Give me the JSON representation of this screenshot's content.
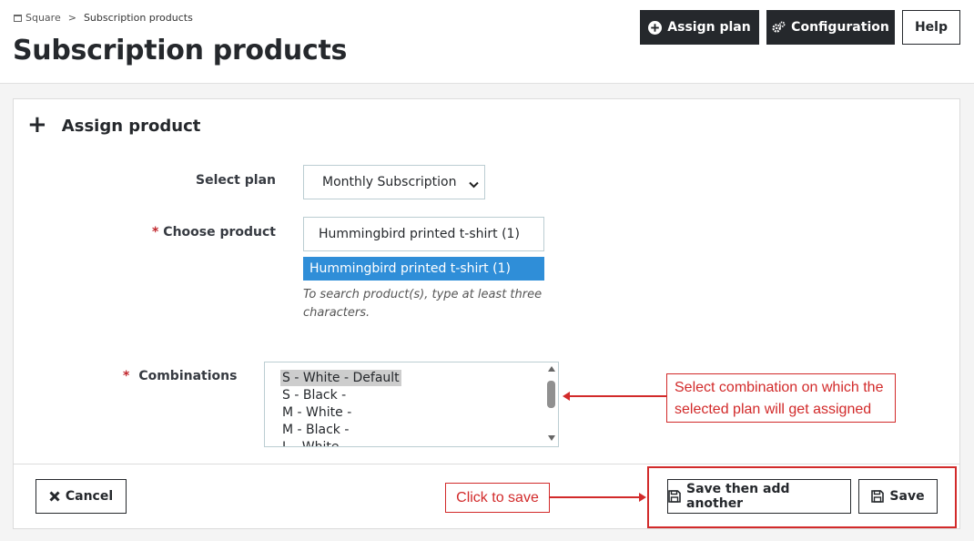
{
  "breadcrumb": {
    "root": "Square",
    "separator": ">",
    "current": "Subscription products"
  },
  "page": {
    "title": "Subscription products"
  },
  "toolbar": {
    "assign_plan": "Assign plan",
    "configuration": "Configuration",
    "help": "Help"
  },
  "panel": {
    "title": "Assign product",
    "select_plan": {
      "label": "Select plan",
      "value": "Monthly Subscription"
    },
    "choose_product": {
      "required_mark": "*",
      "label": "Choose product",
      "value": "Hummingbird printed t-shirt (1)",
      "suggestion": "Hummingbird printed t-shirt (1)",
      "hint": "To search product(s), type at least three characters."
    },
    "combinations": {
      "required_mark": "*",
      "label": "Combinations",
      "options": [
        "S - White - Default",
        "S - Black -",
        "M - White -",
        "M - Black -",
        "L - White -"
      ],
      "selected_index": 0
    }
  },
  "footer": {
    "cancel": "Cancel",
    "save_add": "Save then add another",
    "save": "Save"
  },
  "annotations": {
    "combination_note": "Select combination on which the selected plan will get assigned",
    "save_note": "Click to save"
  },
  "colors": {
    "accent": "#25282c",
    "highlight": "#2f8ed8",
    "annotation": "#d22a2a",
    "required": "#c1272d"
  },
  "icons": {
    "breadcrumb": "store-icon",
    "assign": "plus-circle-icon",
    "config": "gears-icon",
    "add": "plus-icon",
    "cancel": "close-icon",
    "save": "floppy-disk-icon"
  }
}
